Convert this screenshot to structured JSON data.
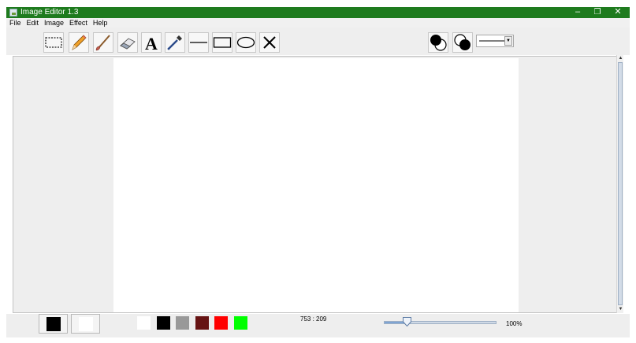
{
  "window": {
    "title": "Image Editor 1.3",
    "titlebar_color": "#1e7b1e",
    "controls": [
      "minimize-icon",
      "restore-icon",
      "close-icon"
    ]
  },
  "menu": {
    "items": [
      {
        "label": "File"
      },
      {
        "label": "Edit"
      },
      {
        "label": "Image"
      },
      {
        "label": "Effect"
      },
      {
        "label": "Help"
      }
    ]
  },
  "toolbar": {
    "tools": [
      {
        "name": "select",
        "icon": "rectangle-select-icon"
      },
      {
        "name": "pencil",
        "icon": "pencil-icon"
      },
      {
        "name": "brush",
        "icon": "brush-icon"
      },
      {
        "name": "eraser",
        "icon": "eraser-icon"
      },
      {
        "name": "text",
        "icon": "text-icon",
        "glyph": "A"
      },
      {
        "name": "color-picker",
        "icon": "eyedropper-icon"
      },
      {
        "name": "line",
        "icon": "line-icon"
      },
      {
        "name": "rectangle",
        "icon": "rectangle-icon"
      },
      {
        "name": "ellipse",
        "icon": "ellipse-icon"
      },
      {
        "name": "close",
        "icon": "x-icon"
      }
    ],
    "fill_modes": [
      {
        "name": "fill-foreground",
        "icon": "fill-outline-icon"
      },
      {
        "name": "fill-background",
        "icon": "outline-fill-icon"
      }
    ],
    "line_style": {
      "icon": "line-style-icon"
    }
  },
  "status": {
    "primary_color": "#000000",
    "secondary_color": "#ffffff",
    "palette": [
      "#ffffff",
      "#000000",
      "#999999",
      "#661313",
      "#ff0000",
      "#00ff00"
    ],
    "coordinates": "753 : 209",
    "zoom_label": "100%",
    "zoom_fraction": 0.2
  }
}
